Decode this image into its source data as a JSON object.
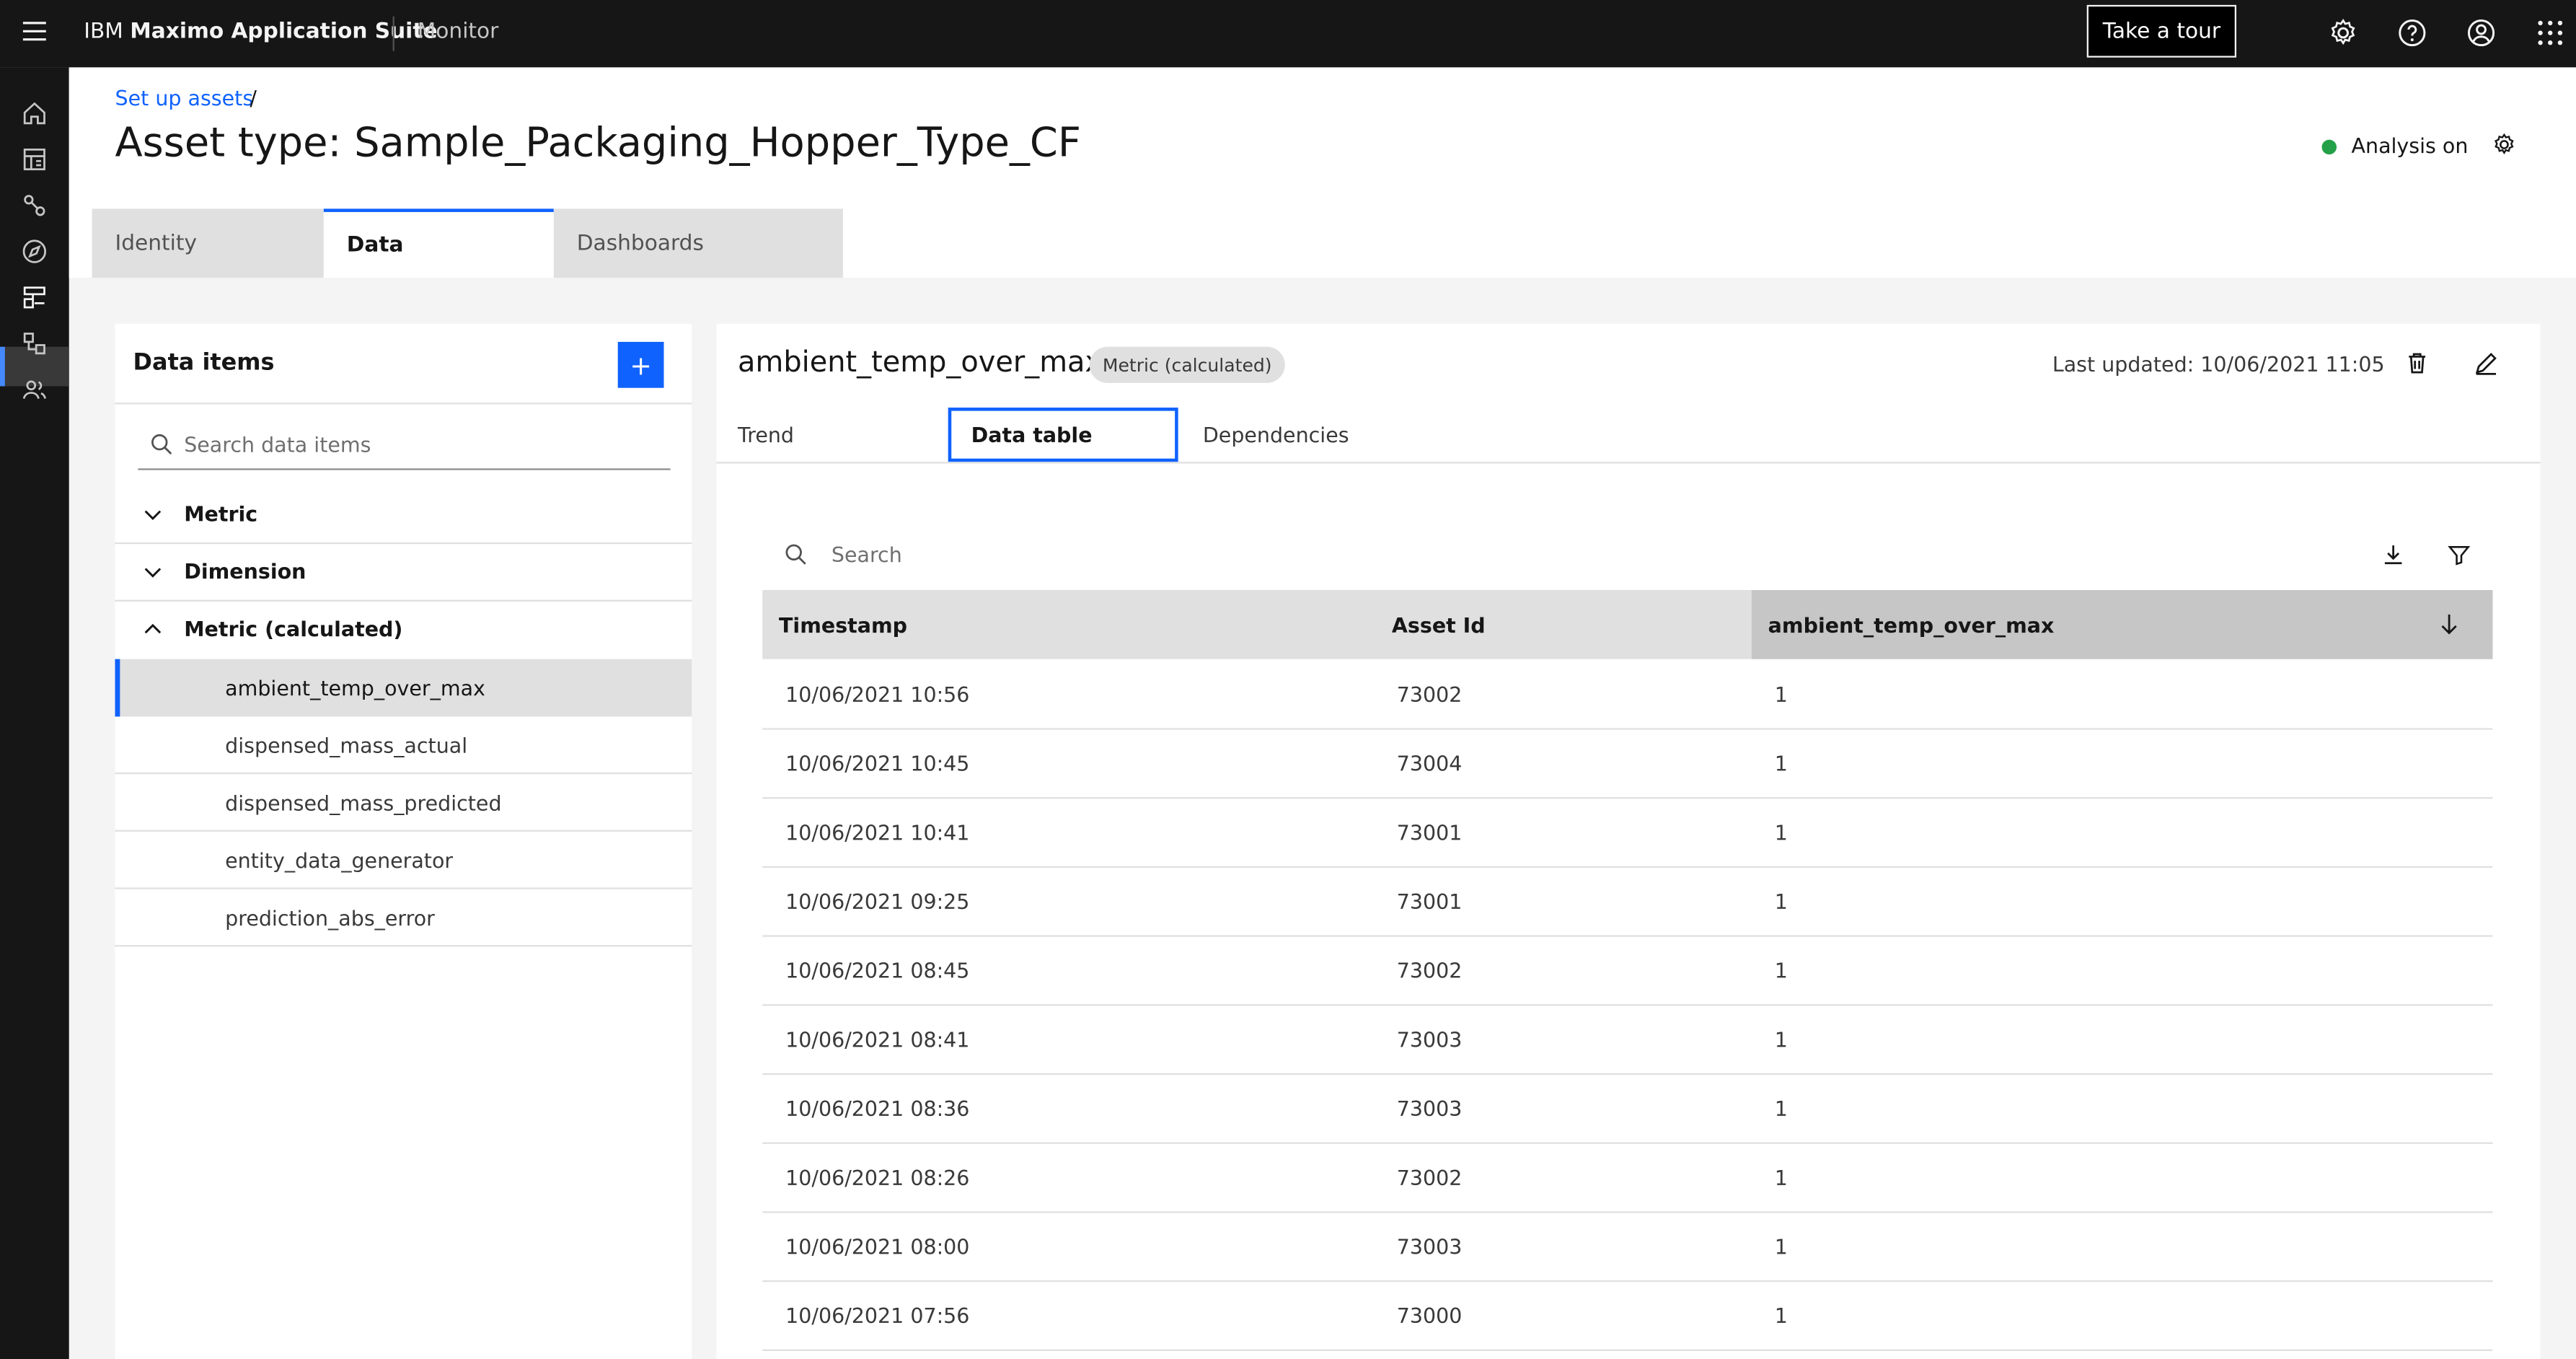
{
  "header": {
    "brand_prefix": "IBM",
    "brand_name": "Maximo Application Suite",
    "app_name": "Monitor",
    "tour_label": "Take a tour",
    "icons": [
      "menu-icon",
      "settings-icon",
      "help-icon",
      "user-icon",
      "app-switcher-icon"
    ]
  },
  "sidenav": {
    "icons": [
      "home-icon",
      "dashboard-icon",
      "asset-icon",
      "explore-icon",
      "setup-assets-icon",
      "hierarchy-icon",
      "users-icon"
    ],
    "selected_index": 4
  },
  "breadcrumb": {
    "link": "Set up assets",
    "separator": "/"
  },
  "page": {
    "title": "Asset type: Sample_Packaging_Hopper_Type_CF",
    "status": "Analysis on",
    "status_color": "#24a148"
  },
  "tabs": [
    "Identity",
    "Data",
    "Dashboards"
  ],
  "active_tab": "Data",
  "data_items": {
    "title": "Data items",
    "add_label": "+",
    "search_placeholder": "Search data items",
    "groups": [
      {
        "label": "Metric",
        "expanded": false,
        "items": []
      },
      {
        "label": "Dimension",
        "expanded": false,
        "items": []
      },
      {
        "label": "Metric (calculated)",
        "expanded": true,
        "items": [
          "ambient_temp_over_max",
          "dispensed_mass_actual",
          "dispensed_mass_predicted",
          "entity_data_generator",
          "prediction_abs_error"
        ]
      }
    ],
    "selected_item": "ambient_temp_over_max"
  },
  "detail": {
    "name": "ambient_temp_over_max",
    "type_tag": "Metric (calculated)",
    "last_updated": "Last updated: 10/06/2021 11:05",
    "subtabs": [
      "Trend",
      "Data table",
      "Dependencies"
    ],
    "active_subtab": "Data table",
    "search_placeholder": "Search"
  },
  "table": {
    "columns": [
      "Timestamp",
      "Asset Id",
      "ambient_temp_over_max"
    ],
    "sorted_column": "ambient_temp_over_max",
    "rows": [
      [
        "10/06/2021 10:56",
        "73002",
        "1"
      ],
      [
        "10/06/2021 10:45",
        "73004",
        "1"
      ],
      [
        "10/06/2021 10:41",
        "73001",
        "1"
      ],
      [
        "10/06/2021 09:25",
        "73001",
        "1"
      ],
      [
        "10/06/2021 08:45",
        "73002",
        "1"
      ],
      [
        "10/06/2021 08:41",
        "73003",
        "1"
      ],
      [
        "10/06/2021 08:36",
        "73003",
        "1"
      ],
      [
        "10/06/2021 08:26",
        "73002",
        "1"
      ],
      [
        "10/06/2021 08:00",
        "73003",
        "1"
      ],
      [
        "10/06/2021 07:56",
        "73000",
        "1"
      ]
    ]
  }
}
